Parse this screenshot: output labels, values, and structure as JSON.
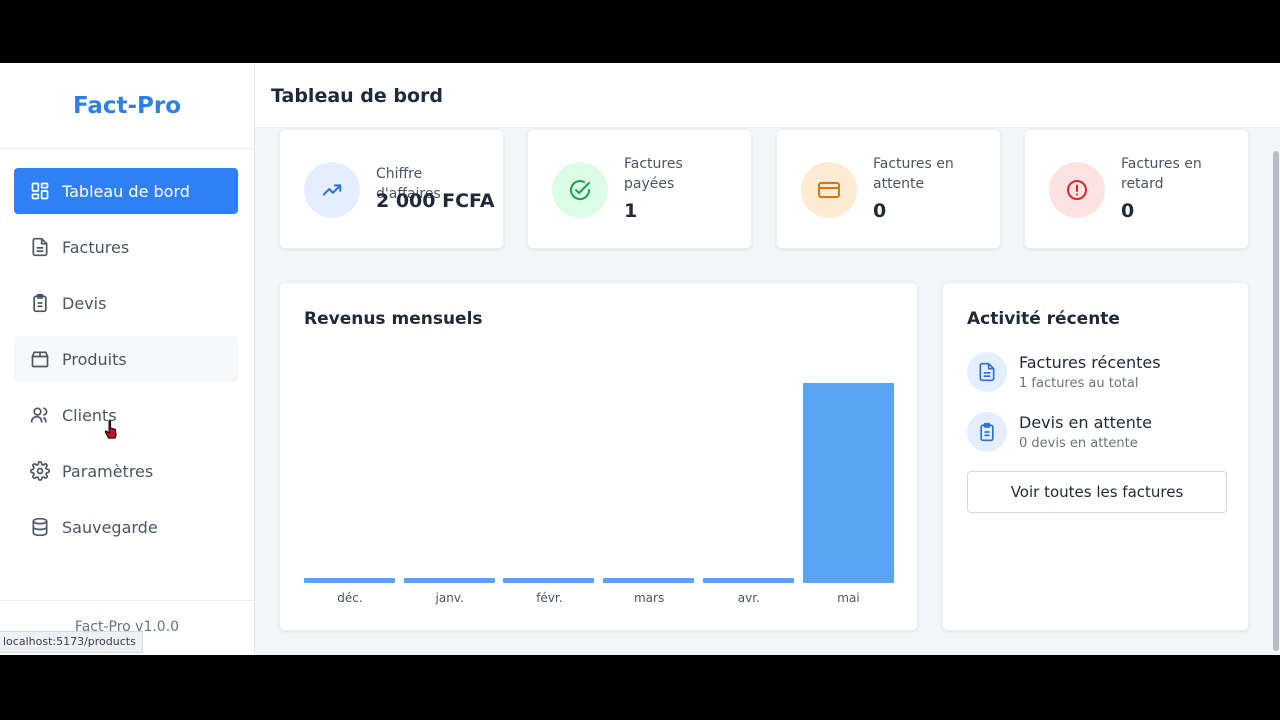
{
  "brand": "Fact-Pro",
  "sidebar": {
    "items": [
      {
        "label": "Tableau de bord",
        "icon": "dashboard-icon"
      },
      {
        "label": "Factures",
        "icon": "document-icon"
      },
      {
        "label": "Devis",
        "icon": "clipboard-icon"
      },
      {
        "label": "Produits",
        "icon": "package-icon"
      },
      {
        "label": "Clients",
        "icon": "users-icon"
      },
      {
        "label": "Paramètres",
        "icon": "gear-icon"
      },
      {
        "label": "Sauvegarde",
        "icon": "database-icon"
      }
    ],
    "footer": "Fact-Pro v1.0.0"
  },
  "status_url": "localhost:5173/products",
  "header": {
    "title": "Tableau de bord"
  },
  "stats": [
    {
      "label": "Chiffre d'affaires",
      "value": "2 000 FCFA",
      "icon": "trending-up-icon",
      "color": "#3b82f6"
    },
    {
      "label": "Factures payées",
      "value": "1",
      "icon": "check-circle-icon",
      "color": "#22c55e"
    },
    {
      "label": "Factures en attente",
      "value": "0",
      "icon": "credit-card-icon",
      "color": "#f59e0b"
    },
    {
      "label": "Factures en retard",
      "value": "0",
      "icon": "alert-circle-icon",
      "color": "#ef4444"
    }
  ],
  "revenue": {
    "title": "Revenus mensuels"
  },
  "chart_data": {
    "type": "bar",
    "categories": [
      "déc.",
      "janv.",
      "févr.",
      "mars",
      "avr.",
      "mai"
    ],
    "values": [
      0,
      0,
      0,
      0,
      0,
      2000
    ],
    "title": "Revenus mensuels",
    "color": "#5aa5f3"
  },
  "activity": {
    "title": "Activité récente",
    "items": [
      {
        "title": "Factures récentes",
        "subtitle": "1 factures au total",
        "icon": "document-icon"
      },
      {
        "title": "Devis en attente",
        "subtitle": "0 devis en attente",
        "icon": "clipboard-icon"
      }
    ],
    "button": "Voir toutes les factures"
  }
}
